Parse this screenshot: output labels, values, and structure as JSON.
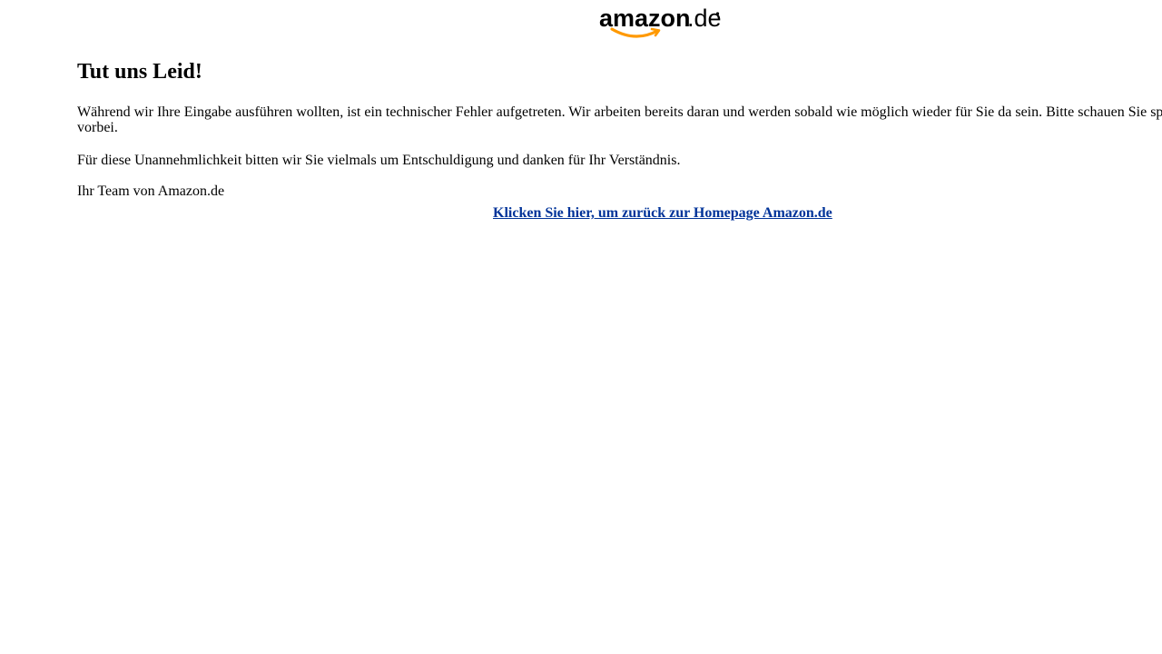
{
  "logo": {
    "wordmark": "amazon",
    "suffix": ".de",
    "smile_color": "#FF9900"
  },
  "error": {
    "title": "Tut uns Leid!",
    "message": "Während wir Ihre Eingabe ausführen wollten, ist ein technischer Fehler aufgetreten. Wir arbeiten bereits daran und werden sobald wie möglich wieder für Sie da sein. Bitte schauen Sie sp vorbei.",
    "apology": "Für diese Unannehmlichkeit bitten wir Sie vielmals um Entschuldigung und danken für Ihr Verständnis.",
    "signature": "Ihr Team von Amazon.de"
  },
  "home_link": {
    "label": "Klicken Sie hier, um zurück zur Homepage Amazon.de",
    "color": "#003399"
  }
}
